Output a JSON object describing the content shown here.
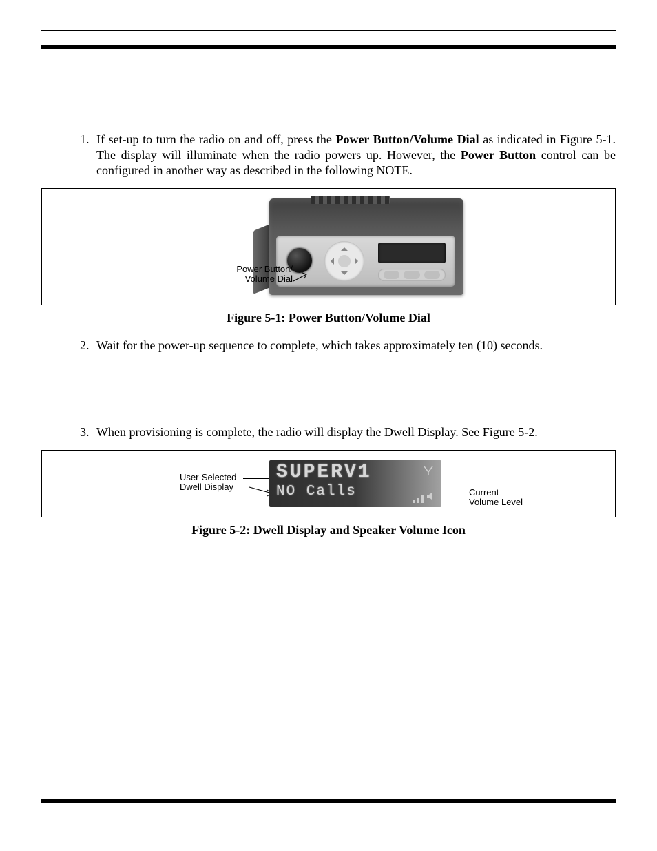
{
  "steps": {
    "s1_a": "If set-up to turn the radio on and off, press the ",
    "s1_bold1": "Power Button/Volume Dial",
    "s1_b": " as indicated in Figure 5-1. The display will illuminate when the radio powers up. However, the ",
    "s1_bold2": "Power Button",
    "s1_c": " control can be configured in another way as described in the following NOTE.",
    "s2": "Wait for the power-up sequence to complete, which takes approximately ten (10) seconds.",
    "s3": "When provisioning is complete, the radio will display the Dwell Display. See Figure 5-2."
  },
  "figure1": {
    "callout_line1": "Power Button/",
    "callout_line2": "Volume Dial",
    "caption": "Figure 5-1: Power Button/Volume Dial"
  },
  "figure2": {
    "lcd_line1": "SUPERV1",
    "lcd_line2": "NO Calls",
    "left_label_line1": "User-Selected",
    "left_label_line2": "Dwell Display",
    "right_label_line1": "Current",
    "right_label_line2": "Volume Level",
    "caption": "Figure 5-2: Dwell Display and Speaker Volume Icon"
  }
}
